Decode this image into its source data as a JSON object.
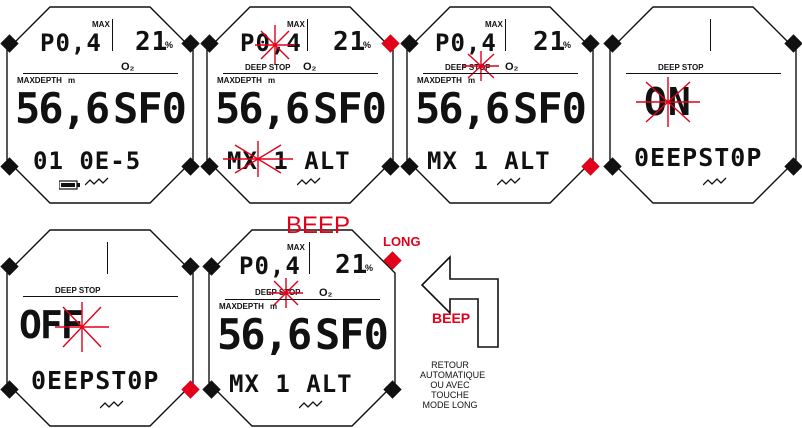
{
  "labels": {
    "max": "MAX",
    "maxdepth": "MAXDEPTH",
    "unit_m": "m",
    "deep_stop": "DEEP STOP",
    "o2": "O₂",
    "percent": "%"
  },
  "screens": [
    {
      "po": "P0,4",
      "o2v": "21",
      "depth": "56,6",
      "right": "SF0",
      "bottom": "01 0E-5"
    },
    {
      "po": "P0,4",
      "o2v": "21",
      "depth": "56,6",
      "right": "SF0",
      "bottom": "MX 1  ALT"
    },
    {
      "po": "P0,4",
      "o2v": "21",
      "depth": "56,6",
      "right": "SF0",
      "bottom": "MX 1  ALT"
    },
    {
      "big": "ON",
      "bottom": "0EEPST0P"
    },
    {
      "big": "OFF",
      "bottom": "0EEPST0P"
    },
    {
      "po": "P0,4",
      "o2v": "21",
      "depth": "56,6",
      "right": "SF0",
      "bottom": "MX 1  ALT"
    }
  ],
  "annotations": {
    "beep_top": "BEEP",
    "long": "LONG",
    "beep_arrow": "BEEP",
    "caption_lines": [
      "RETOUR",
      "AUTOMATIQUE",
      "OU AVEC",
      "TOUCHE",
      "MODE LONG"
    ]
  },
  "colors": {
    "accent": "#e2001a",
    "lcd": "#111111"
  }
}
